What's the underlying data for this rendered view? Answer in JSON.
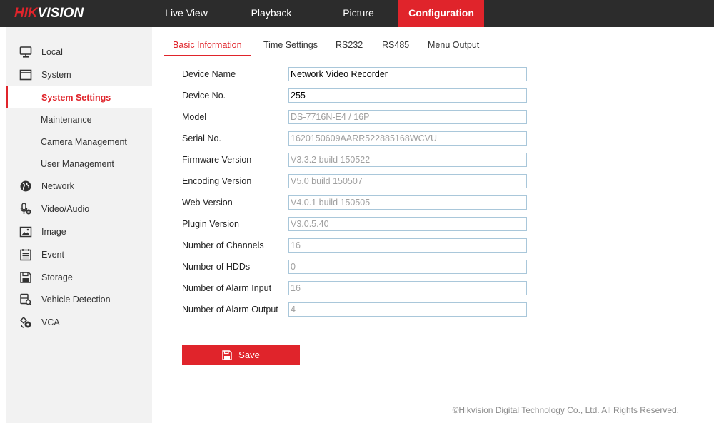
{
  "brand": {
    "part1": "HIK",
    "part2": "VISION"
  },
  "nav": {
    "live_view": "Live View",
    "playback": "Playback",
    "picture": "Picture",
    "configuration": "Configuration"
  },
  "sidebar": {
    "items": [
      {
        "label": "Local",
        "icon": "monitor-icon"
      },
      {
        "label": "System",
        "icon": "window-icon"
      },
      {
        "label": "System Settings",
        "active": true
      },
      {
        "label": "Maintenance"
      },
      {
        "label": "Camera Management"
      },
      {
        "label": "User Management"
      },
      {
        "label": "Network",
        "icon": "globe-icon"
      },
      {
        "label": "Video/Audio",
        "icon": "microphone-icon"
      },
      {
        "label": "Image",
        "icon": "image-icon"
      },
      {
        "label": "Event",
        "icon": "event-list-icon"
      },
      {
        "label": "Storage",
        "icon": "floppy-disk-icon"
      },
      {
        "label": "Vehicle Detection",
        "icon": "vehicle-icon"
      },
      {
        "label": "VCA",
        "icon": "vca-icon"
      }
    ]
  },
  "tabs": [
    {
      "label": "Basic Information",
      "active": true
    },
    {
      "label": "Time Settings"
    },
    {
      "label": "RS232"
    },
    {
      "label": "RS485"
    },
    {
      "label": "Menu Output"
    }
  ],
  "form": {
    "fields": [
      {
        "label": "Device Name",
        "value": "Network Video Recorder",
        "readonly": false
      },
      {
        "label": "Device No.",
        "value": "255",
        "readonly": false
      },
      {
        "label": "Model",
        "value": "DS-7716N-E4 / 16P",
        "readonly": true
      },
      {
        "label": "Serial No.",
        "value": "1620150609AARR522885168WCVU",
        "readonly": true
      },
      {
        "label": "Firmware Version",
        "value": "V3.3.2 build 150522",
        "readonly": true
      },
      {
        "label": "Encoding Version",
        "value": "V5.0 build 150507",
        "readonly": true
      },
      {
        "label": "Web Version",
        "value": "V4.0.1 build 150505",
        "readonly": true
      },
      {
        "label": "Plugin Version",
        "value": "V3.0.5.40",
        "readonly": true
      },
      {
        "label": "Number of Channels",
        "value": "16",
        "readonly": true
      },
      {
        "label": "Number of HDDs",
        "value": "0",
        "readonly": true
      },
      {
        "label": "Number of Alarm Input",
        "value": "16",
        "readonly": true
      },
      {
        "label": "Number of Alarm Output",
        "value": "4",
        "readonly": true
      }
    ],
    "save_label": "Save"
  },
  "footer": {
    "copyright": "©Hikvision Digital Technology Co., Ltd. All Rights Reserved."
  },
  "colors": {
    "accent": "#e0242b",
    "topbar": "#2c2c2c",
    "sidebar": "#f2f2f2",
    "input_border": "#a9c7da"
  }
}
